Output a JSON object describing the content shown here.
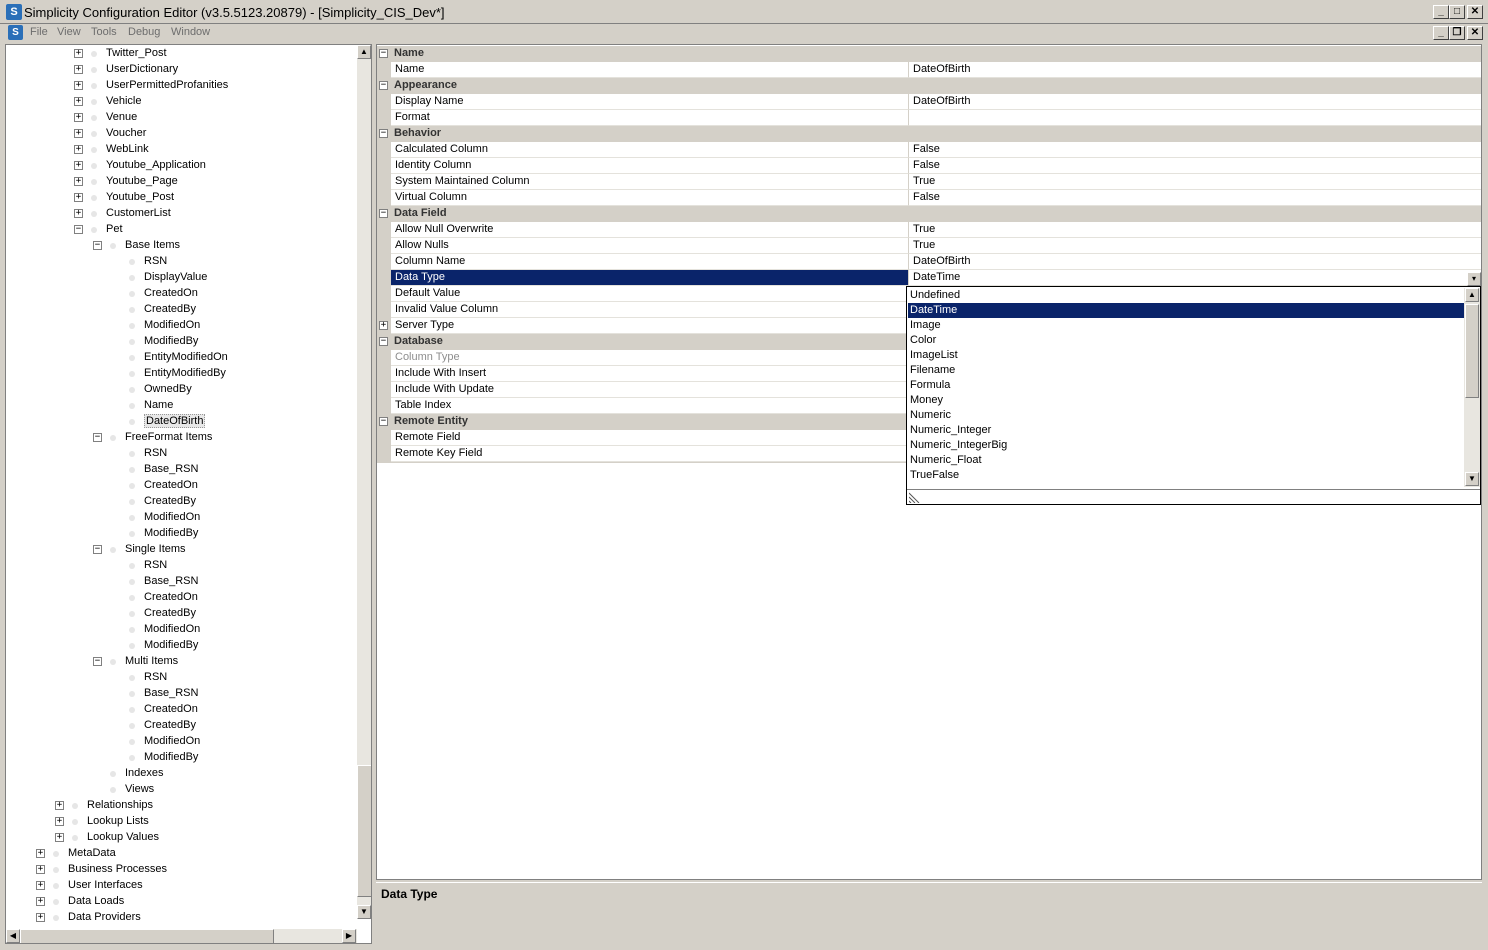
{
  "window": {
    "title": "Simplicity Configuration Editor (v3.5.5123.20879) - [Simplicity_CIS_Dev*]",
    "app_icon": "S",
    "controls": [
      "_",
      "□",
      "✕"
    ],
    "child_controls": [
      "_",
      "❐",
      "✕"
    ]
  },
  "menu": [
    "File",
    "View",
    "Tools",
    "Debug",
    "Window"
  ],
  "tree": {
    "nodes": [
      {
        "label": "Twitter_Post",
        "level": 3,
        "exp": "+"
      },
      {
        "label": "UserDictionary",
        "level": 3,
        "exp": "+"
      },
      {
        "label": "UserPermittedProfanities",
        "level": 3,
        "exp": "+"
      },
      {
        "label": "Vehicle",
        "level": 3,
        "exp": "+"
      },
      {
        "label": "Venue",
        "level": 3,
        "exp": "+"
      },
      {
        "label": "Voucher",
        "level": 3,
        "exp": "+"
      },
      {
        "label": "WebLink",
        "level": 3,
        "exp": "+"
      },
      {
        "label": "Youtube_Application",
        "level": 3,
        "exp": "+"
      },
      {
        "label": "Youtube_Page",
        "level": 3,
        "exp": "+"
      },
      {
        "label": "Youtube_Post",
        "level": 3,
        "exp": "+"
      },
      {
        "label": "CustomerList",
        "level": 3,
        "exp": "+"
      },
      {
        "label": "Pet",
        "level": 3,
        "exp": "−"
      },
      {
        "label": "Base Items",
        "level": 4,
        "exp": "−"
      },
      {
        "label": "RSN",
        "level": 5,
        "exp": ""
      },
      {
        "label": "DisplayValue",
        "level": 5,
        "exp": ""
      },
      {
        "label": "CreatedOn",
        "level": 5,
        "exp": ""
      },
      {
        "label": "CreatedBy",
        "level": 5,
        "exp": ""
      },
      {
        "label": "ModifiedOn",
        "level": 5,
        "exp": ""
      },
      {
        "label": "ModifiedBy",
        "level": 5,
        "exp": ""
      },
      {
        "label": "EntityModifiedOn",
        "level": 5,
        "exp": ""
      },
      {
        "label": "EntityModifiedBy",
        "level": 5,
        "exp": ""
      },
      {
        "label": "OwnedBy",
        "level": 5,
        "exp": ""
      },
      {
        "label": "Name",
        "level": 5,
        "exp": ""
      },
      {
        "label": "DateOfBirth",
        "level": 5,
        "exp": "",
        "selected": true
      },
      {
        "label": "FreeFormat Items",
        "level": 4,
        "exp": "−"
      },
      {
        "label": "RSN",
        "level": 5,
        "exp": ""
      },
      {
        "label": "Base_RSN",
        "level": 5,
        "exp": ""
      },
      {
        "label": "CreatedOn",
        "level": 5,
        "exp": ""
      },
      {
        "label": "CreatedBy",
        "level": 5,
        "exp": ""
      },
      {
        "label": "ModifiedOn",
        "level": 5,
        "exp": ""
      },
      {
        "label": "ModifiedBy",
        "level": 5,
        "exp": ""
      },
      {
        "label": "Single Items",
        "level": 4,
        "exp": "−"
      },
      {
        "label": "RSN",
        "level": 5,
        "exp": ""
      },
      {
        "label": "Base_RSN",
        "level": 5,
        "exp": ""
      },
      {
        "label": "CreatedOn",
        "level": 5,
        "exp": ""
      },
      {
        "label": "CreatedBy",
        "level": 5,
        "exp": ""
      },
      {
        "label": "ModifiedOn",
        "level": 5,
        "exp": ""
      },
      {
        "label": "ModifiedBy",
        "level": 5,
        "exp": ""
      },
      {
        "label": "Multi Items",
        "level": 4,
        "exp": "−"
      },
      {
        "label": "RSN",
        "level": 5,
        "exp": ""
      },
      {
        "label": "Base_RSN",
        "level": 5,
        "exp": ""
      },
      {
        "label": "CreatedOn",
        "level": 5,
        "exp": ""
      },
      {
        "label": "CreatedBy",
        "level": 5,
        "exp": ""
      },
      {
        "label": "ModifiedOn",
        "level": 5,
        "exp": ""
      },
      {
        "label": "ModifiedBy",
        "level": 5,
        "exp": ""
      },
      {
        "label": "Indexes",
        "level": 4,
        "exp": ""
      },
      {
        "label": "Views",
        "level": 4,
        "exp": ""
      },
      {
        "label": "Relationships",
        "level": 2,
        "exp": "+"
      },
      {
        "label": "Lookup Lists",
        "level": 2,
        "exp": "+"
      },
      {
        "label": "Lookup Values",
        "level": 2,
        "exp": "+"
      },
      {
        "label": "MetaData",
        "level": 1,
        "exp": "+"
      },
      {
        "label": "Business Processes",
        "level": 1,
        "exp": "+"
      },
      {
        "label": "User Interfaces",
        "level": 1,
        "exp": "+"
      },
      {
        "label": "Data Loads",
        "level": 1,
        "exp": "+"
      },
      {
        "label": "Data Providers",
        "level": 1,
        "exp": "+"
      }
    ]
  },
  "properties": [
    {
      "type": "cat",
      "label": "Name",
      "exp": "−"
    },
    {
      "type": "prop",
      "name": "Name",
      "value": "DateOfBirth"
    },
    {
      "type": "cat",
      "label": "Appearance",
      "exp": "−"
    },
    {
      "type": "prop",
      "name": "Display Name",
      "value": "DateOfBirth"
    },
    {
      "type": "prop",
      "name": "Format",
      "value": ""
    },
    {
      "type": "cat",
      "label": "Behavior",
      "exp": "−"
    },
    {
      "type": "prop",
      "name": "Calculated Column",
      "value": "False"
    },
    {
      "type": "prop",
      "name": "Identity Column",
      "value": "False"
    },
    {
      "type": "prop",
      "name": "System Maintained Column",
      "value": "True"
    },
    {
      "type": "prop",
      "name": "Virtual Column",
      "value": "False"
    },
    {
      "type": "cat",
      "label": "Data Field",
      "exp": "−"
    },
    {
      "type": "prop",
      "name": "Allow Null Overwrite",
      "value": "True"
    },
    {
      "type": "prop",
      "name": "Allow Nulls",
      "value": "True"
    },
    {
      "type": "prop",
      "name": "Column Name",
      "value": "DateOfBirth"
    },
    {
      "type": "prop",
      "name": "Data Type",
      "value": "DateTime",
      "selected": true
    },
    {
      "type": "prop",
      "name": "Default Value",
      "value": ""
    },
    {
      "type": "prop",
      "name": "Invalid Value Column",
      "value": ""
    },
    {
      "type": "prop",
      "name": "Server Type",
      "value": "",
      "exp": "+"
    },
    {
      "type": "cat",
      "label": "Database",
      "exp": "−"
    },
    {
      "type": "prop",
      "name": "Column Type",
      "value": "",
      "disabled": true
    },
    {
      "type": "prop",
      "name": "Include With Insert",
      "value": ""
    },
    {
      "type": "prop",
      "name": "Include With Update",
      "value": ""
    },
    {
      "type": "prop",
      "name": "Table Index",
      "value": ""
    },
    {
      "type": "cat",
      "label": "Remote Entity",
      "exp": "−"
    },
    {
      "type": "prop",
      "name": "Remote Field",
      "value": ""
    },
    {
      "type": "prop",
      "name": "Remote Key Field",
      "value": ""
    }
  ],
  "dropdown": {
    "items": [
      "Undefined",
      "DateTime",
      "Image",
      "Color",
      "ImageList",
      "Filename",
      "Formula",
      "Money",
      "Numeric",
      "Numeric_Integer",
      "Numeric_IntegerBig",
      "Numeric_Float",
      "TrueFalse"
    ],
    "selected_index": 1
  },
  "description": {
    "title": "Data Type"
  }
}
